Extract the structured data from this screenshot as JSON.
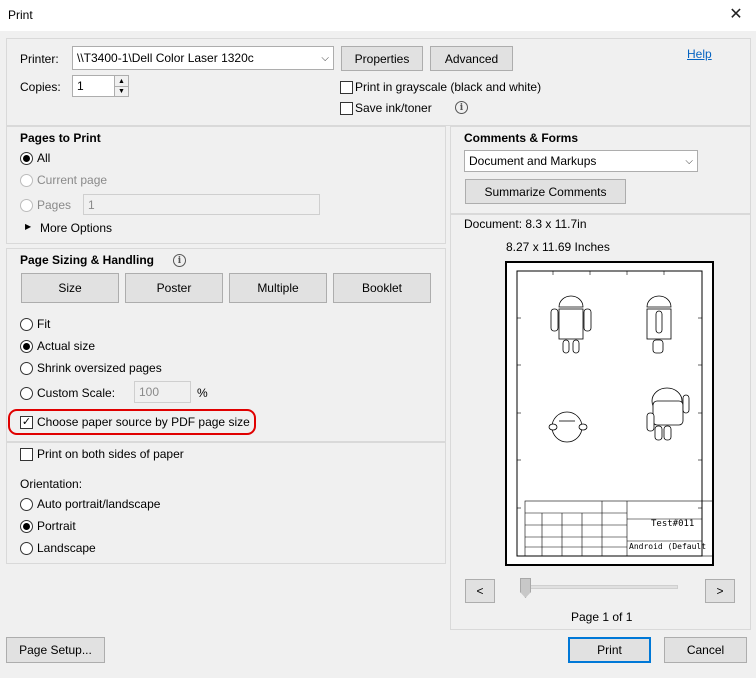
{
  "window": {
    "title": "Print",
    "close_glyph": "✕"
  },
  "printer": {
    "label": "Printer:",
    "value": "\\\\T3400-1\\Dell Color Laser 1320c",
    "properties_label": "Properties",
    "advanced_label": "Advanced",
    "help_label": "Help"
  },
  "copies": {
    "label": "Copies:",
    "value": "1"
  },
  "options": {
    "grayscale_label": "Print in grayscale (black and white)",
    "grayscale_checked": false,
    "save_ink_label": "Save ink/toner",
    "save_ink_checked": false
  },
  "pages_to_print": {
    "title": "Pages to Print",
    "all_label": "All",
    "current_label": "Current page",
    "pages_label": "Pages",
    "pages_value": "1",
    "selected": "all",
    "more_options_label": "More Options"
  },
  "sizing": {
    "title": "Page Sizing & Handling",
    "tabs": [
      "Size",
      "Poster",
      "Multiple",
      "Booklet"
    ],
    "fit_label": "Fit",
    "actual_label": "Actual size",
    "shrink_label": "Shrink oversized pages",
    "custom_label": "Custom Scale:",
    "custom_value": "100",
    "custom_unit": "%",
    "selected": "actual",
    "paper_source_label": "Choose paper source by PDF page size",
    "paper_source_checked": true,
    "both_sides_label": "Print on both sides of paper",
    "both_sides_checked": false
  },
  "orientation": {
    "label": "Orientation:",
    "auto_label": "Auto portrait/landscape",
    "portrait_label": "Portrait",
    "landscape_label": "Landscape",
    "selected": "portrait"
  },
  "comments": {
    "title": "Comments & Forms",
    "value": "Document and Markups",
    "summarize_label": "Summarize Comments"
  },
  "preview": {
    "document_size": "Document: 8.3 x 11.7in",
    "paper_size": "8.27 x 11.69 Inches",
    "title_block_text": "Test#011",
    "title_block_sub": "Android (Default",
    "prev_label": "<",
    "next_label": ">",
    "page_info": "Page 1 of 1",
    "slider_fraction": 0
  },
  "footer": {
    "page_setup_label": "Page Setup...",
    "print_label": "Print",
    "cancel_label": "Cancel"
  },
  "icons": {
    "check": "✓",
    "down_arrow": "⌵",
    "up_small": "▲",
    "down_small": "▼",
    "triangle_right": "▶",
    "info": "i"
  },
  "colors": {
    "accent": "#0078d7",
    "highlight": "#e00000",
    "link": "#0563c1"
  }
}
